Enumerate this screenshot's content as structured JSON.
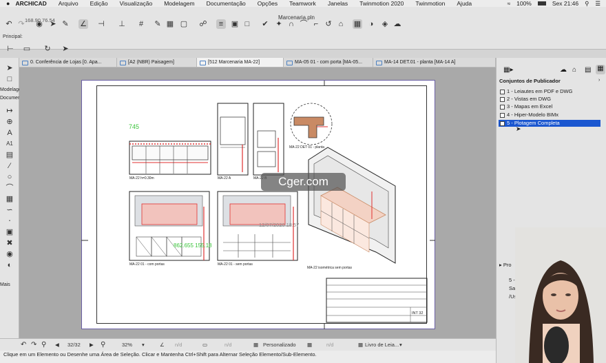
{
  "menubar": {
    "items": [
      "ARCHICAD",
      "Arquivo",
      "Edição",
      "Visualização",
      "Modelagem",
      "Documentação",
      "Opções",
      "Teamwork",
      "Janelas",
      "Twinmotion 2020",
      "Twinmotion",
      "Ajuda"
    ],
    "battery": "100%",
    "clock": "Sex 21:46"
  },
  "toolbar": {
    "doc_title": "Marcenaria.pln",
    "coord_readout": "168.90 76.54",
    "info_label": "Principal:"
  },
  "tabs": [
    {
      "label": "0. Conferência de Lojas [0. Apa...",
      "active": false
    },
    {
      "label": "[A2 (NBR) Paisagem]",
      "active": false
    },
    {
      "label": "[512 Marcenaria MA-22]",
      "active": true
    },
    {
      "label": "MA-05 01 - com porta [MA-05...",
      "active": false
    },
    {
      "label": "MA-14 DET.01 - planta [MA-14 A]",
      "active": false
    }
  ],
  "toolbox": {
    "labels": [
      "Modelagem",
      "Documentação",
      "A1",
      "Mais"
    ]
  },
  "drawing": {
    "dim_green_1": "745",
    "dim_green_2": "862.655 155.18",
    "timestamp": "12/07/2020 18:57",
    "labels": {
      "elev_1": "MA-22 h=0.30m",
      "elev_a": "MA-22 A",
      "elev_b": "MA-22 B",
      "detail": "MA-22 DET 01 - planta",
      "with_doors": "MA-22 01 - com portas",
      "without_doors": "MA-22 01 - sem portas",
      "isometric": "MA-22 isométrica sem portas"
    },
    "title_block_code": "INT 32"
  },
  "watermark": {
    "text": "Cger.com"
  },
  "statusbar": {
    "page": "32/32",
    "zoom": "32%",
    "angle": "n/d",
    "scale": "n/d",
    "layer_combo": "Personalizado",
    "model_view": "n/d",
    "book": "Livro de Leia..."
  },
  "hint": {
    "text": "Clique em um Elemento ou Desenhe uma Área de Seleção. Clicar e Mantenha Ctrl+Shift para Alternar Seleção Elemento/Sub-Elemento."
  },
  "publisher": {
    "title": "Conjuntos de Publicador",
    "items": [
      {
        "label": "1 - Leiautes em PDF e DWG",
        "selected": false
      },
      {
        "label": "2 - Vistas em DWG",
        "selected": false
      },
      {
        "label": "3 - Mapas em Excel",
        "selected": false
      },
      {
        "label": "4 - Hiper-Modelo BIMx",
        "selected": false
      },
      {
        "label": "5 - Plotagem Completa",
        "selected": true
      }
    ],
    "properties_label": "Pro",
    "prop_rows": [
      "5 -",
      "Sal",
      "/Us"
    ]
  },
  "colors": {
    "accent": "#1b57d0",
    "dim_green": "#3ac43a",
    "red_lines": "#e03030",
    "sheet_border": "#6a5fa4"
  }
}
